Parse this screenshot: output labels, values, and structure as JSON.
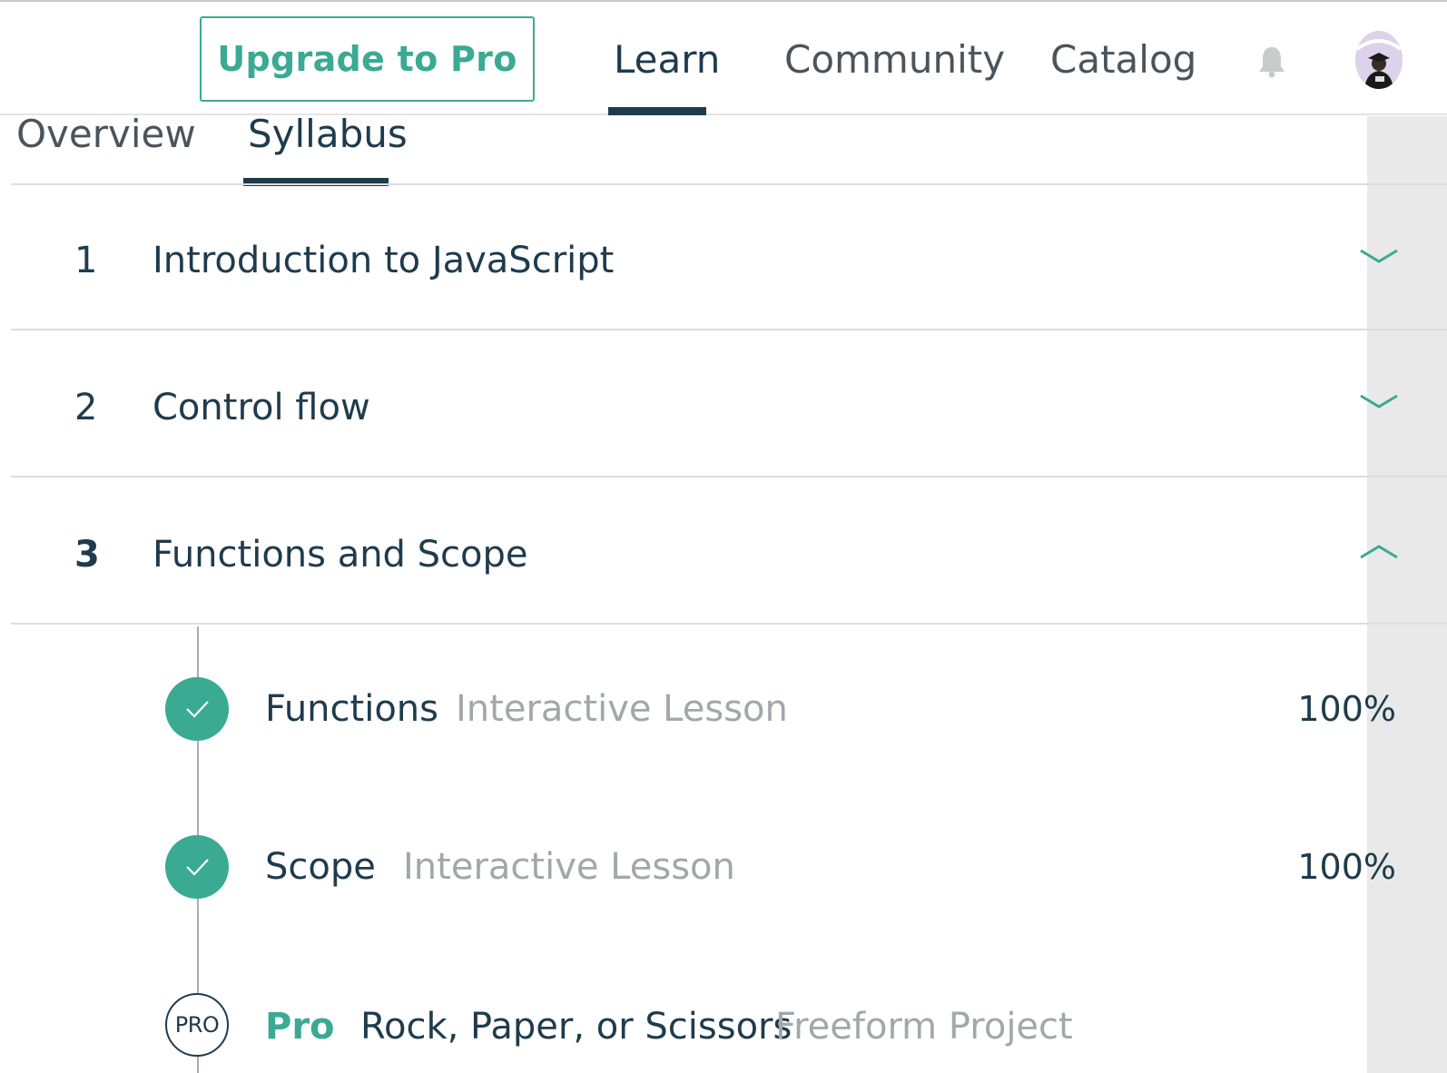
{
  "header": {
    "upgrade_label": "Upgrade to Pro",
    "nav": [
      "Learn",
      "Community",
      "Catalog"
    ],
    "active_nav": "Learn"
  },
  "tabs": [
    "Overview",
    "Syllabus"
  ],
  "active_tab": "Syllabus",
  "modules": [
    {
      "number": "1",
      "title": "Introduction to JavaScript",
      "expanded": false
    },
    {
      "number": "2",
      "title": "Control flow",
      "expanded": false
    },
    {
      "number": "3",
      "title": "Functions and Scope",
      "expanded": true
    }
  ],
  "lessons": [
    {
      "title": "Functions",
      "type": "Interactive Lesson",
      "progress": "100%",
      "status": "complete"
    },
    {
      "title": "Scope",
      "type": "Interactive Lesson",
      "progress": "100%",
      "status": "complete"
    },
    {
      "badge": "PRO",
      "pro_label": "Pro",
      "title": "Rock, Paper, or Scissors",
      "type": "Freeform Project",
      "status": "locked"
    }
  ],
  "colors": {
    "accent": "#3aaa92",
    "text": "#1f3b4d",
    "muted": "#a3a7aa",
    "gutter": "#e8e9e8"
  },
  "icons": [
    "bell-icon",
    "avatar",
    "chevron-down-icon",
    "chevron-up-icon",
    "check-icon"
  ]
}
